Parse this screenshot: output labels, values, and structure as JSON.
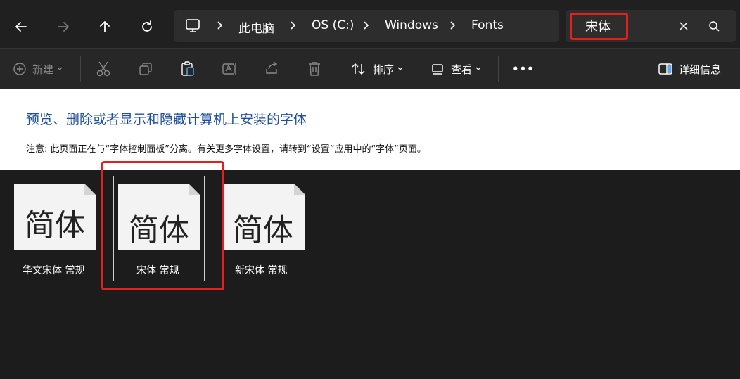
{
  "nav": {
    "back_icon": "arrow-left-icon",
    "forward_icon": "arrow-right-icon",
    "up_icon": "arrow-up-icon",
    "refresh_icon": "refresh-icon"
  },
  "breadcrumb": {
    "root_icon": "computer-icon",
    "items": [
      "此电脑",
      "OS (C:)",
      "Windows",
      "Fonts"
    ]
  },
  "search": {
    "value": "宋体",
    "clear_icon": "close-icon",
    "search_icon": "search-icon"
  },
  "toolbar": {
    "new_label": "新建",
    "sort_label": "排序",
    "view_label": "查看",
    "more_label": "•••",
    "details_label": "详细信息"
  },
  "info": {
    "title": "预览、删除或者显示和隐藏计算机上安装的字体",
    "note": "注意: 此页面正在与“字体控制面板”分离。有关更多字体设置，请转到“设置”应用中的“字体”页面。"
  },
  "fonts": [
    {
      "preview": "简体",
      "name": "华文宋体 常规"
    },
    {
      "preview": "简体",
      "name": "宋体 常规"
    },
    {
      "preview": "简体",
      "name": "新宋体 常规"
    }
  ],
  "colors": {
    "highlight": "#e5201a",
    "info_title": "#1e4f9c"
  }
}
